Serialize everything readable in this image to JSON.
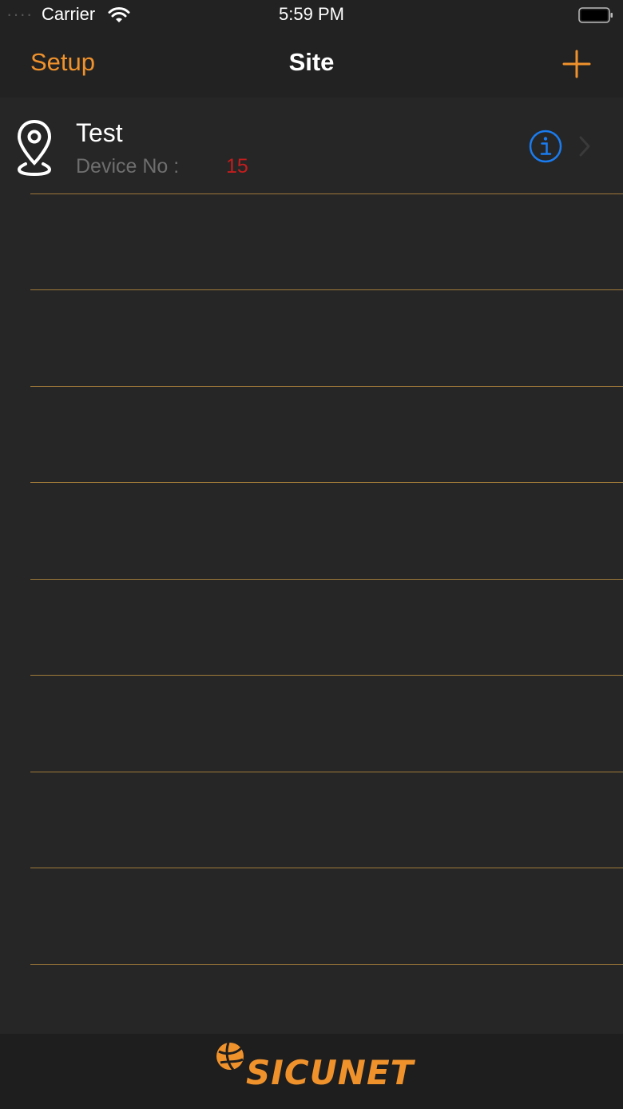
{
  "status_bar": {
    "carrier": "Carrier",
    "time": "5:59 PM",
    "icons": [
      "wifi-icon",
      "battery-icon"
    ]
  },
  "nav": {
    "left_label": "Setup",
    "title": "Site",
    "right_icon": "plus-icon"
  },
  "sites": [
    {
      "name": "Test",
      "device_label": "Device No :",
      "device_count": "15"
    }
  ],
  "footer": {
    "logo_text": "SICUNET"
  },
  "colors": {
    "accent": "#f0922c",
    "background": "#262626",
    "bar": "#222222",
    "separator": "#a07a3a",
    "count": "#c41d1d",
    "info": "#1a7cf0"
  }
}
